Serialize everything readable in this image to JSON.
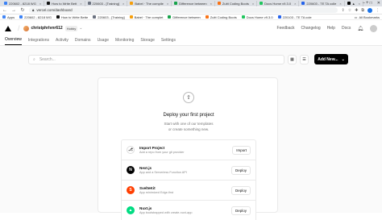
{
  "browser": {
    "tabs": [
      {
        "label": "220602 - 8218 WG",
        "color": "#3b82f6"
      },
      {
        "label": "How to Write Bett",
        "color": "#111111"
      },
      {
        "label": "220603 - [Training]",
        "color": "#6b7280"
      },
      {
        "label": "Babel · The compile",
        "color": "#f59e0b"
      },
      {
        "label": "Difference between",
        "color": "#16a34a"
      },
      {
        "label": "Zuitt Coding Boots",
        "color": "#f97316"
      },
      {
        "label": "Docs Home v9.3.0",
        "color": "#22c55e"
      },
      {
        "label": "220603 - TE TA colle",
        "color": "#2563eb"
      },
      {
        "label": "▲",
        "color": "#000000"
      }
    ],
    "url": "vercel.com/dashboard",
    "bookmarks": [
      {
        "label": "Apps",
        "color": "#4285f4"
      },
      {
        "label": "220602 - 8218 WG",
        "color": "#3b82f6"
      },
      {
        "label": "How to Write Bette",
        "color": "#111111"
      },
      {
        "label": "220603 - [Training]",
        "color": "#6b7280"
      },
      {
        "label": "Babel · The complet",
        "color": "#f59e0b"
      },
      {
        "label": "Difference between",
        "color": "#16a34a"
      },
      {
        "label": "Zuitt Coding Boots",
        "color": "#f97316"
      },
      {
        "label": "Docs Home v9.3.0",
        "color": "#22c55e"
      },
      {
        "label": "220103 - TE TA cole",
        "color": "#2563eb"
      }
    ],
    "bookmarks_right": "All Bookmarks"
  },
  "header": {
    "account": "christphrlvnr612",
    "plan": "Hobby",
    "links": [
      "Feedback",
      "Changelog",
      "Help",
      "Docs"
    ]
  },
  "nav": {
    "tabs": [
      "Overview",
      "Integrations",
      "Activity",
      "Domains",
      "Usage",
      "Monitoring",
      "Storage",
      "Settings"
    ],
    "active": "Overview"
  },
  "overview": {
    "search_placeholder": "Search...",
    "add_new": "Add New...",
    "empty_title": "Deploy your first project",
    "empty_sub1": "Start with one of our templates",
    "empty_sub2": "or create something new.",
    "templates": [
      {
        "name": "Import Project",
        "desc": "Add a repo from your git provider",
        "button": "Import",
        "icon_bg": "#ffffff",
        "icon_fg": "#333333",
        "icon_char": "⎇"
      },
      {
        "name": "Next.js",
        "desc": "App and a Serverless Function API",
        "button": "Deploy",
        "icon_bg": "#000000",
        "icon_fg": "#ffffff",
        "icon_char": "N"
      },
      {
        "name": "SvelteKit",
        "desc": "App minimized Edge-first",
        "button": "Deploy",
        "icon_bg": "#ff3e00",
        "icon_fg": "#ffffff",
        "icon_char": "S"
      },
      {
        "name": "Nuxt.js",
        "desc": "App bootstrapped with create-nuxt-app",
        "button": "Deploy",
        "icon_bg": "#00dc82",
        "icon_fg": "#ffffff",
        "icon_char": "▲"
      }
    ]
  }
}
